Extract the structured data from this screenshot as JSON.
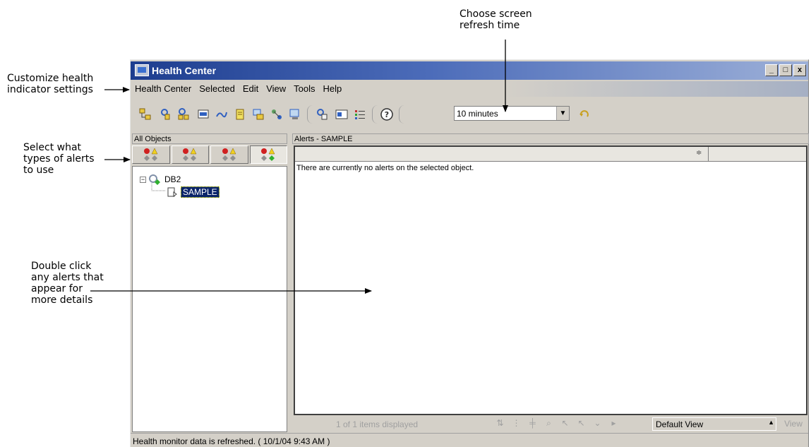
{
  "annotations": {
    "refresh_time": [
      "Choose screen",
      "refresh time"
    ],
    "customize": [
      "Customize health",
      "indicator settings"
    ],
    "alert_types": [
      "Select what",
      "types of alerts",
      "to use"
    ],
    "double_click": [
      "Double click",
      "any alerts that",
      "appear for",
      "more details"
    ]
  },
  "window": {
    "title": "Health Center",
    "buttons": {
      "minimize": "_",
      "maximize": "□",
      "close": "x"
    }
  },
  "menubar": [
    "Health Center",
    "Selected",
    "Edit",
    "View",
    "Tools",
    "Help"
  ],
  "toolbar": {
    "refresh_select": {
      "value": "10 minutes"
    }
  },
  "left_pane": {
    "title": "All Objects",
    "tree": [
      {
        "label": "DB2",
        "level": 0,
        "expanded": true
      },
      {
        "label": "SAMPLE",
        "level": 1,
        "selected": true
      }
    ]
  },
  "right_pane": {
    "title": "Alerts - SAMPLE",
    "empty_message": "There are currently no alerts on the selected object.",
    "items_displayed": "1 of 1 items displayed",
    "view_select": "Default View",
    "view_button": "View"
  },
  "status_bar": "Health monitor data is refreshed. ( 10/1/04 9:43 AM )",
  "colors": {
    "title_gradient_start": "#1d3d8f",
    "title_gradient_end": "#9db0d8",
    "selection": "#0a246a",
    "window_face": "#d4d0c8"
  }
}
